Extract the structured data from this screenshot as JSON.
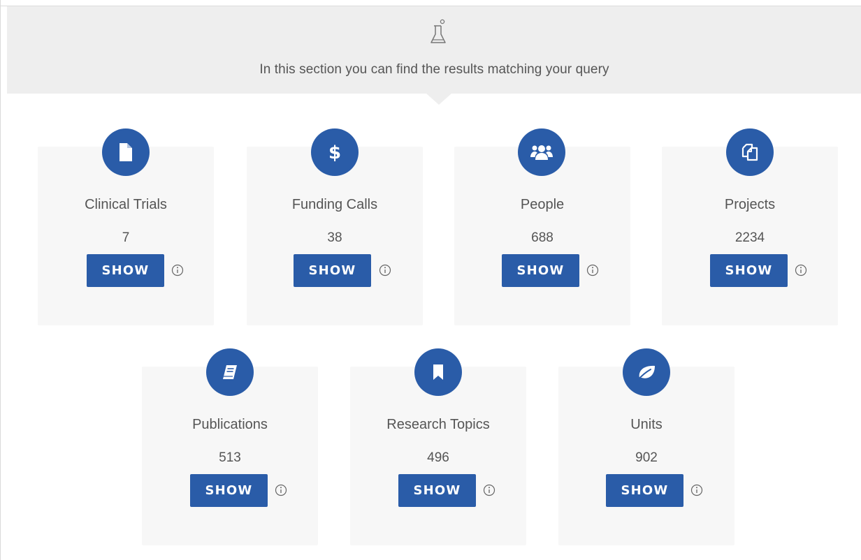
{
  "header": {
    "text": "In this section you can find the results matching your query",
    "icon": "flask-icon"
  },
  "cards": [
    {
      "label": "Clinical Trials",
      "count": "7",
      "button": "SHOW",
      "icon": "file-icon"
    },
    {
      "label": "Funding Calls",
      "count": "38",
      "button": "SHOW",
      "icon": "dollar-icon"
    },
    {
      "label": "People",
      "count": "688",
      "button": "SHOW",
      "icon": "users-icon"
    },
    {
      "label": "Projects",
      "count": "2234",
      "button": "SHOW",
      "icon": "copy-icon"
    },
    {
      "label": "Publications",
      "count": "513",
      "button": "SHOW",
      "icon": "book-icon"
    },
    {
      "label": "Research Topics",
      "count": "496",
      "button": "SHOW",
      "icon": "bookmark-icon"
    },
    {
      "label": "Units",
      "count": "902",
      "button": "SHOW",
      "icon": "leaf-icon"
    }
  ],
  "colors": {
    "accent": "#2a5ca8",
    "card_bg": "#f7f7f7",
    "header_bg": "#eeeeee",
    "text": "#555555"
  }
}
